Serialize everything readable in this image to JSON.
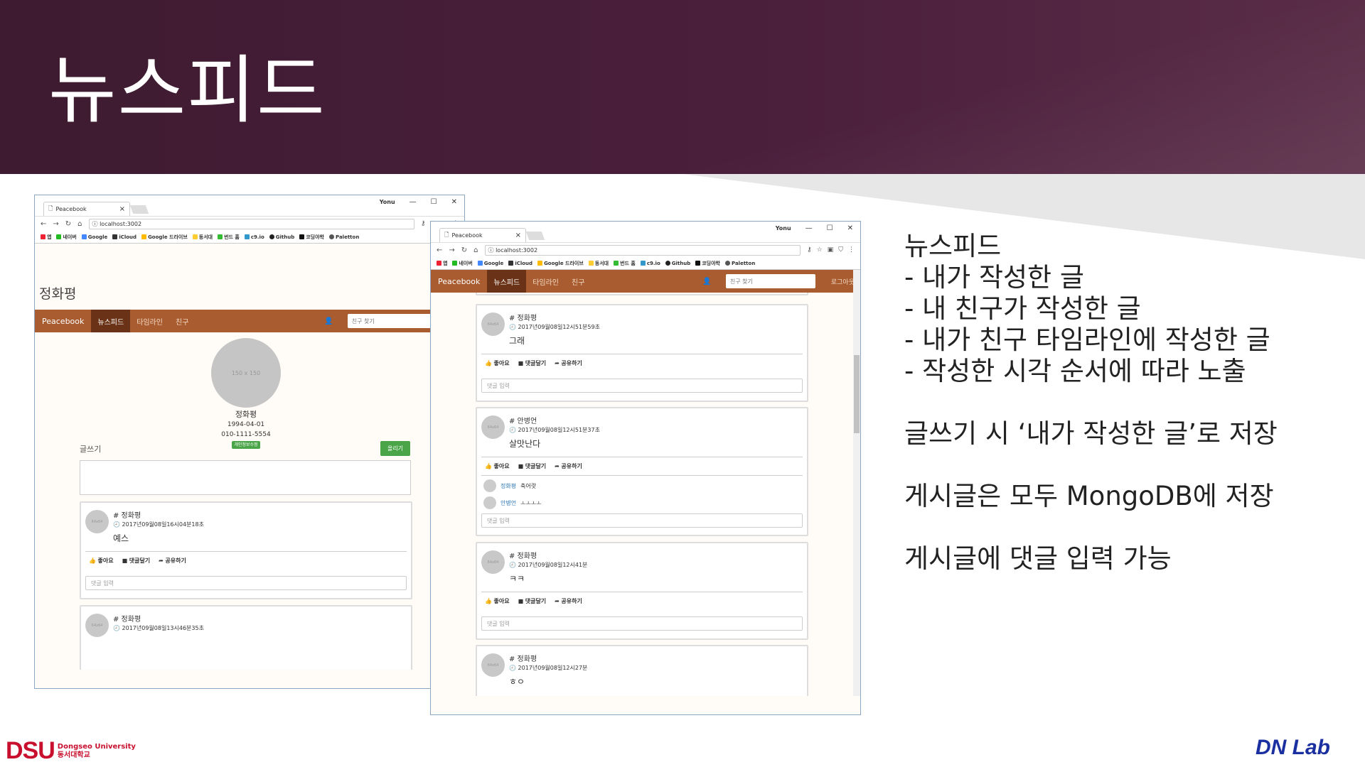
{
  "slide": {
    "title": "뉴스피드",
    "bullets": [
      "뉴스피드",
      "- 내가 작성한 글",
      "- 내 친구가 작성한 글",
      "- 내가 친구 타임라인에 작성한 글",
      "- 작성한 시각 순서에 따라 노출"
    ],
    "note1": "글쓰기 시 ‘내가 작성한 글’로 저장",
    "note2": "게시글은 모두 MongoDB에 저장",
    "note3": "게시글에 댓글 입력 가능",
    "logo_main": "DSU",
    "logo_en": "Dongseo University",
    "logo_kr": "동서대학교",
    "lab": "DN Lab",
    "colors": {
      "header": "#4a1f3c",
      "nav": "#a85c2f",
      "nav_active": "#6a3317",
      "lab": "#1a2fa0"
    }
  },
  "browser": {
    "tab_title": "Peacebook",
    "url": "localhost:3002",
    "user_badge": "Yonu",
    "bookmarks": [
      "앱",
      "네이버",
      "Google",
      "iCloud",
      "Google 드라이브",
      "동서대",
      "번드 홈",
      "c9.io",
      "Github",
      "코딩야학",
      "Paletton"
    ]
  },
  "nav": {
    "brand": "Peacebook",
    "newsfeed": "뉴스피드",
    "timeline": "타임라인",
    "friends": "친구",
    "search_placeholder": "친구 찾기",
    "logout": "로그아웃",
    "logout_short": "로"
  },
  "profile": {
    "name": "정화평",
    "avatar_text": "150 x 150",
    "birth": "1994-04-01",
    "phone": "010-1111-5554",
    "badge": "개인정보수정",
    "write_label": "글쓰기",
    "post_button": "올리기"
  },
  "actions": {
    "like": "좋아요",
    "comment": "댓글달기",
    "share": "공유하기",
    "comment_placeholder": "댓글 입력"
  },
  "left_posts": [
    {
      "author": "# 정화평",
      "time": "2017년09월08일16시04분18초",
      "body": "예스"
    },
    {
      "author": "# 정화평",
      "time": "2017년09월08일13시46분35초",
      "body": ""
    }
  ],
  "right_posts": [
    {
      "author": "# 정화평",
      "time": "2017년09월08일12시51분59초",
      "body": "그래"
    },
    {
      "author": "# 안병언",
      "time": "2017년09월08일12시51분37초",
      "body": "살맛난다"
    },
    {
      "author": "# 정화평",
      "time": "2017년09월08일12시41분",
      "body": "ㅋㅋ"
    },
    {
      "author": "# 정화평",
      "time": "2017년09월08일12시27분",
      "body": "ㅎㅇ"
    }
  ],
  "comments": [
    {
      "name": "정화평",
      "text": "축어랏"
    },
    {
      "name": "안병언",
      "text": "ㅗㅗㅗㅗ"
    }
  ]
}
